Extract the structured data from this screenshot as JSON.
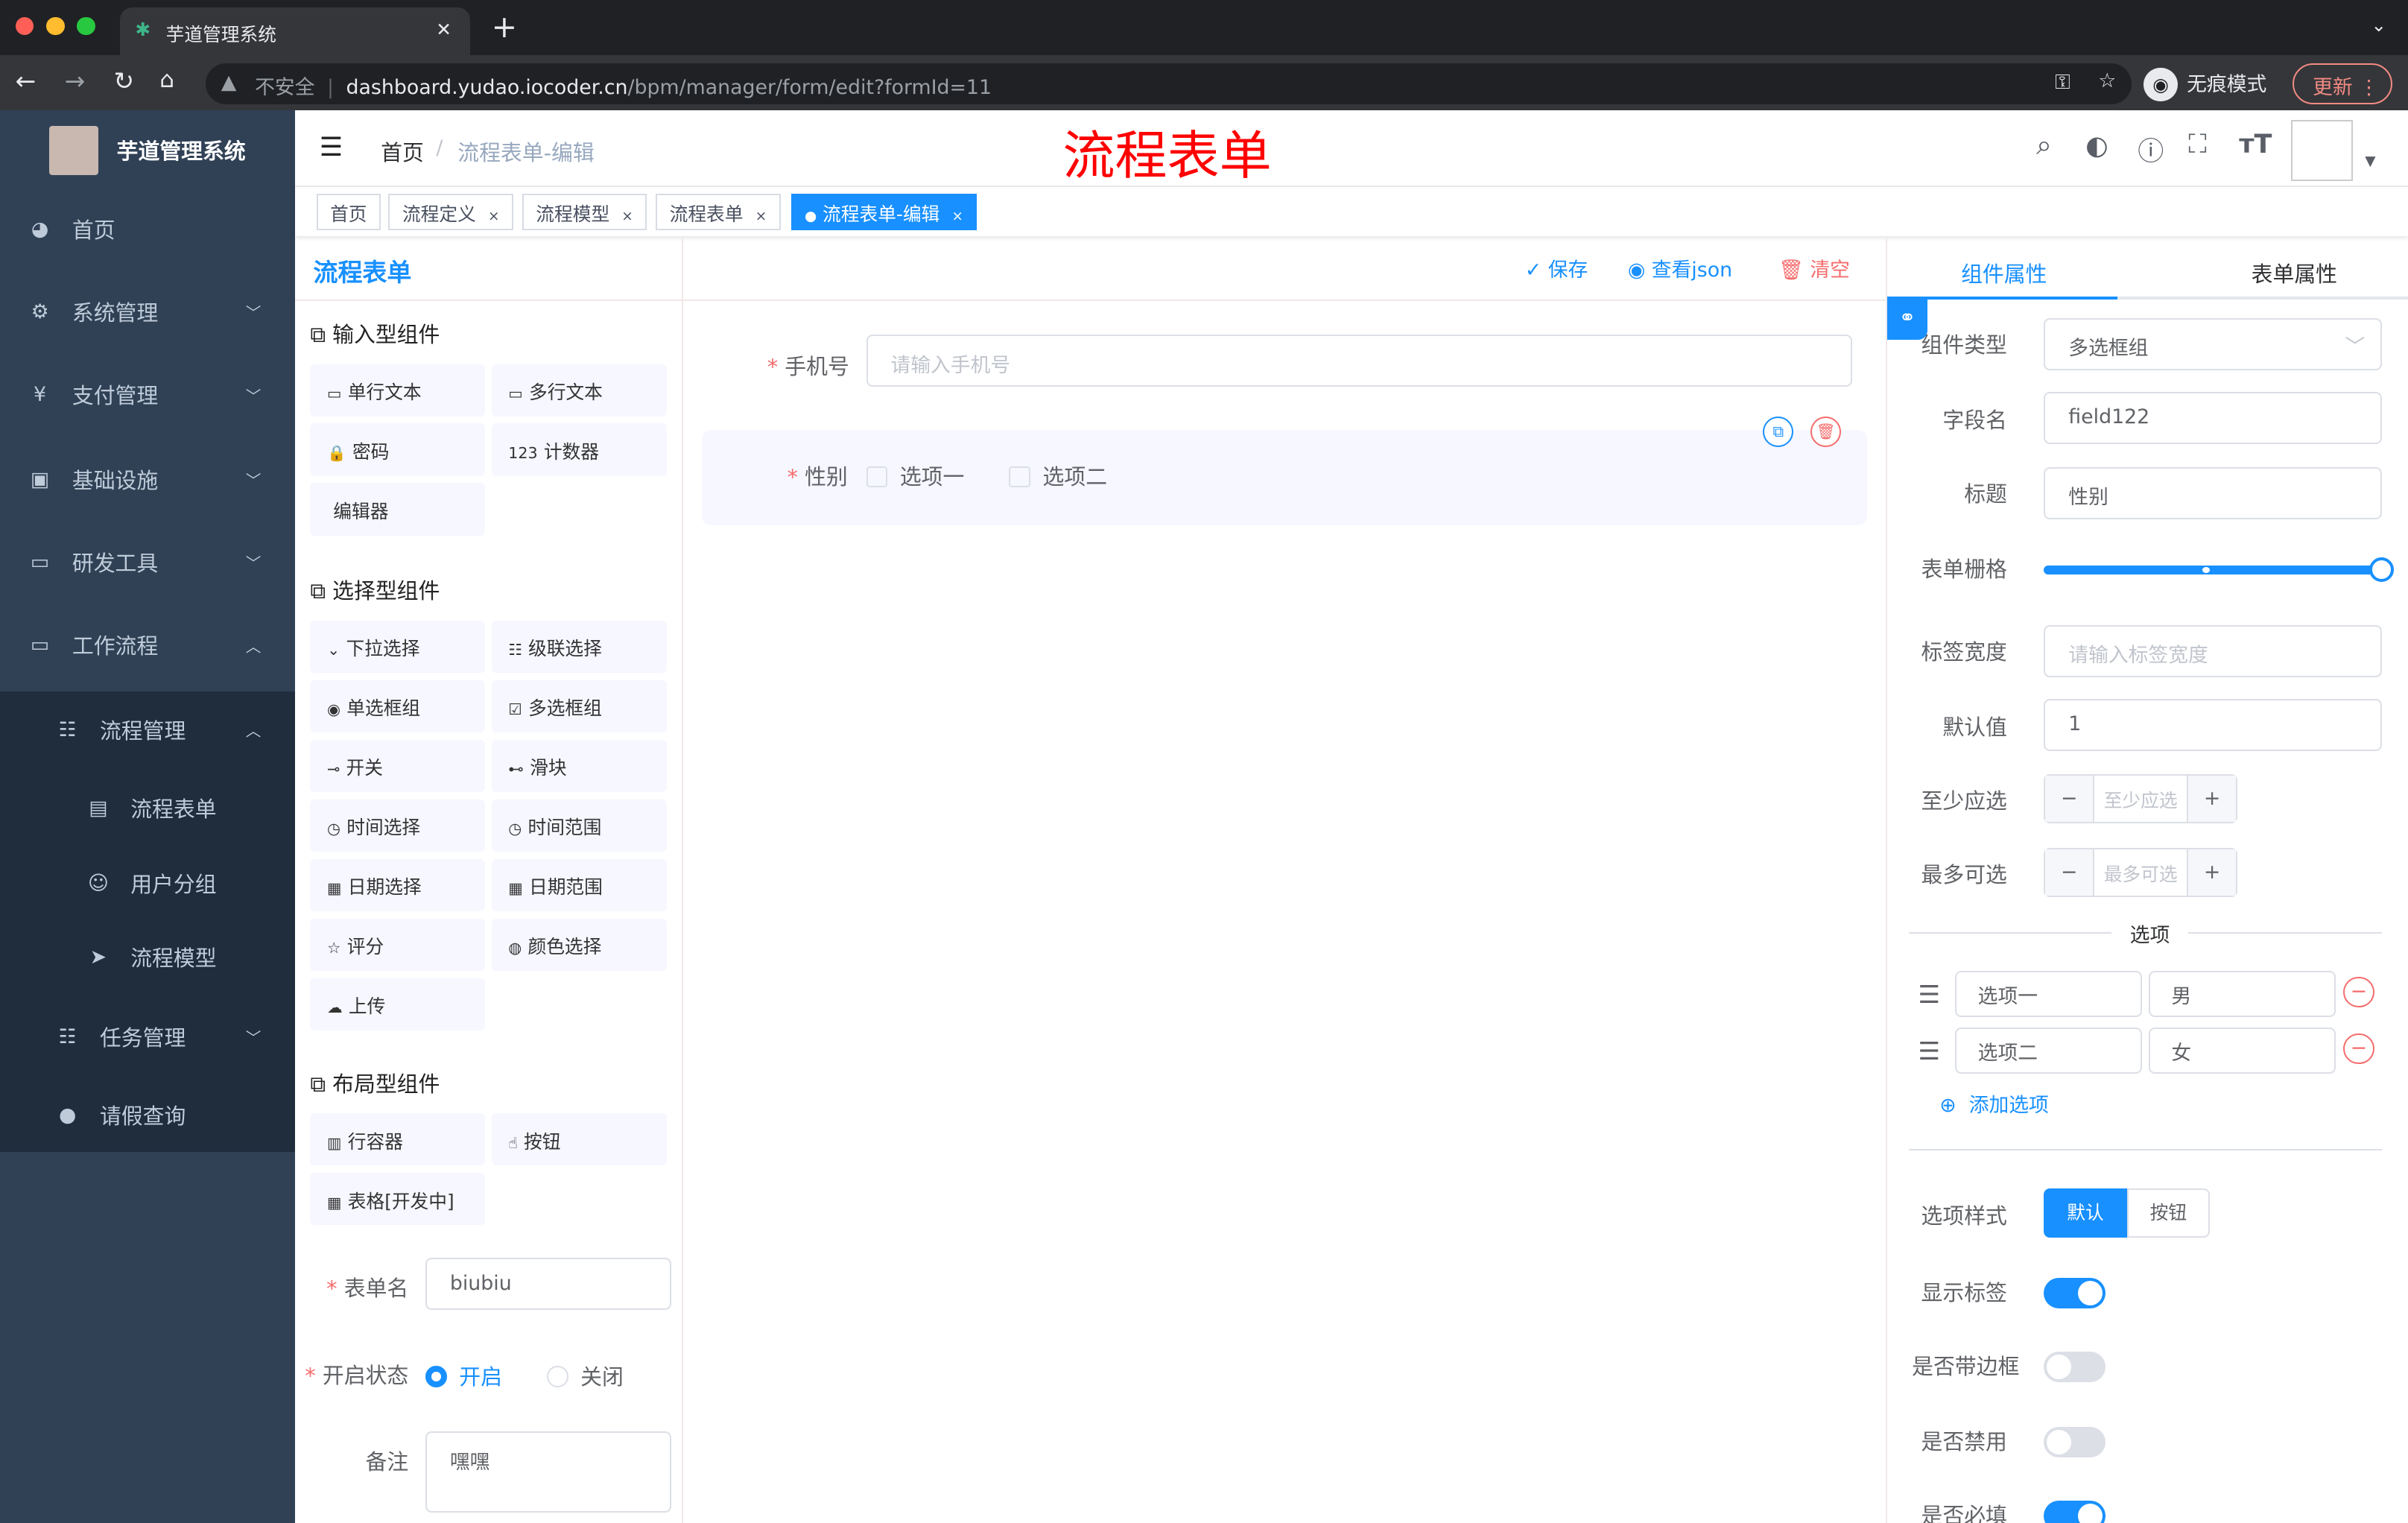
{
  "browser": {
    "tab_title": "芋道管理系统",
    "security": "不安全",
    "url_host": "dashboard.yudao.iocoder.cn",
    "url_path": "/bpm/manager/form/edit?formId=11",
    "incognito": "无痕模式",
    "update": "更新"
  },
  "sidebar": {
    "logo_title": "芋道管理系统",
    "items": [
      {
        "label": "首页",
        "icon": "dashboard-icon"
      },
      {
        "label": "系统管理",
        "icon": "gear-icon"
      },
      {
        "label": "支付管理",
        "icon": "yen-icon"
      },
      {
        "label": "基础设施",
        "icon": "monitor-icon"
      },
      {
        "label": "研发工具",
        "icon": "toolbox-icon"
      },
      {
        "label": "工作流程",
        "icon": "toolbox-icon"
      },
      {
        "label": "流程管理",
        "icon": "tree-icon"
      },
      {
        "label": "流程表单",
        "icon": "form-icon"
      },
      {
        "label": "用户分组",
        "icon": "people-icon"
      },
      {
        "label": "流程模型",
        "icon": "send-icon"
      },
      {
        "label": "任务管理",
        "icon": "tree-icon"
      },
      {
        "label": "请假查询",
        "icon": "user-icon"
      }
    ]
  },
  "header": {
    "breadcrumb_home": "首页",
    "breadcrumb_current": "流程表单-编辑",
    "overlay_title": "流程表单"
  },
  "tags": [
    "首页",
    "流程定义",
    "流程模型",
    "流程表单",
    "流程表单-编辑"
  ],
  "left": {
    "title": "流程表单",
    "groups": [
      {
        "title": "输入型组件",
        "items": [
          "单行文本",
          "多行文本",
          "密码",
          "计数器",
          "编辑器"
        ]
      },
      {
        "title": "选择型组件",
        "items": [
          "下拉选择",
          "级联选择",
          "单选框组",
          "多选框组",
          "开关",
          "滑块",
          "时间选择",
          "时间范围",
          "日期选择",
          "日期范围",
          "评分",
          "颜色选择",
          "上传"
        ]
      },
      {
        "title": "布局型组件",
        "items": [
          "行容器",
          "按钮",
          "表格[开发中]"
        ]
      }
    ],
    "form_name_label": "表单名",
    "form_name": "biubiu",
    "status_label": "开启状态",
    "status_on": "开启",
    "status_off": "关闭",
    "remark_label": "备注",
    "remark": "嘿嘿"
  },
  "toolbar": {
    "save": "保存",
    "view_json": "查看json",
    "clear": "清空"
  },
  "canvas": {
    "phone_label": "手机号",
    "phone_placeholder": "请输入手机号",
    "gender_label": "性别",
    "options": [
      "选项一",
      "选项二"
    ]
  },
  "right": {
    "tabs": [
      "组件属性",
      "表单属性"
    ],
    "component_type_label": "组件类型",
    "component_type": "多选框组",
    "field_label": "字段名",
    "field": "field122",
    "title_label": "标题",
    "title": "性别",
    "grid_label": "表单栅格",
    "grid_value": 24,
    "grid_max": 24,
    "label_width_label": "标签宽度",
    "label_width_placeholder": "请输入标签宽度",
    "default_label": "默认值",
    "default": "1",
    "min_label": "至少应选",
    "min_placeholder": "至少应选",
    "max_label": "最多可选",
    "max_placeholder": "最多可选",
    "options_divider": "选项",
    "options": [
      {
        "label": "选项一",
        "value": "男"
      },
      {
        "label": "选项二",
        "value": "女"
      }
    ],
    "add_option": "添加选项",
    "style_label": "选项样式",
    "style_default": "默认",
    "style_button": "按钮",
    "show_label": "显示标签",
    "show_label_on": true,
    "border_label": "是否带边框",
    "border_on": false,
    "disabled_label": "是否禁用",
    "disabled_on": false,
    "required_label": "是否必填",
    "required_on": true
  },
  "colors": {
    "primary": "#1890ff",
    "sidebar": "#304156",
    "danger": "#f56c6c",
    "title_red": "#ff0000"
  }
}
